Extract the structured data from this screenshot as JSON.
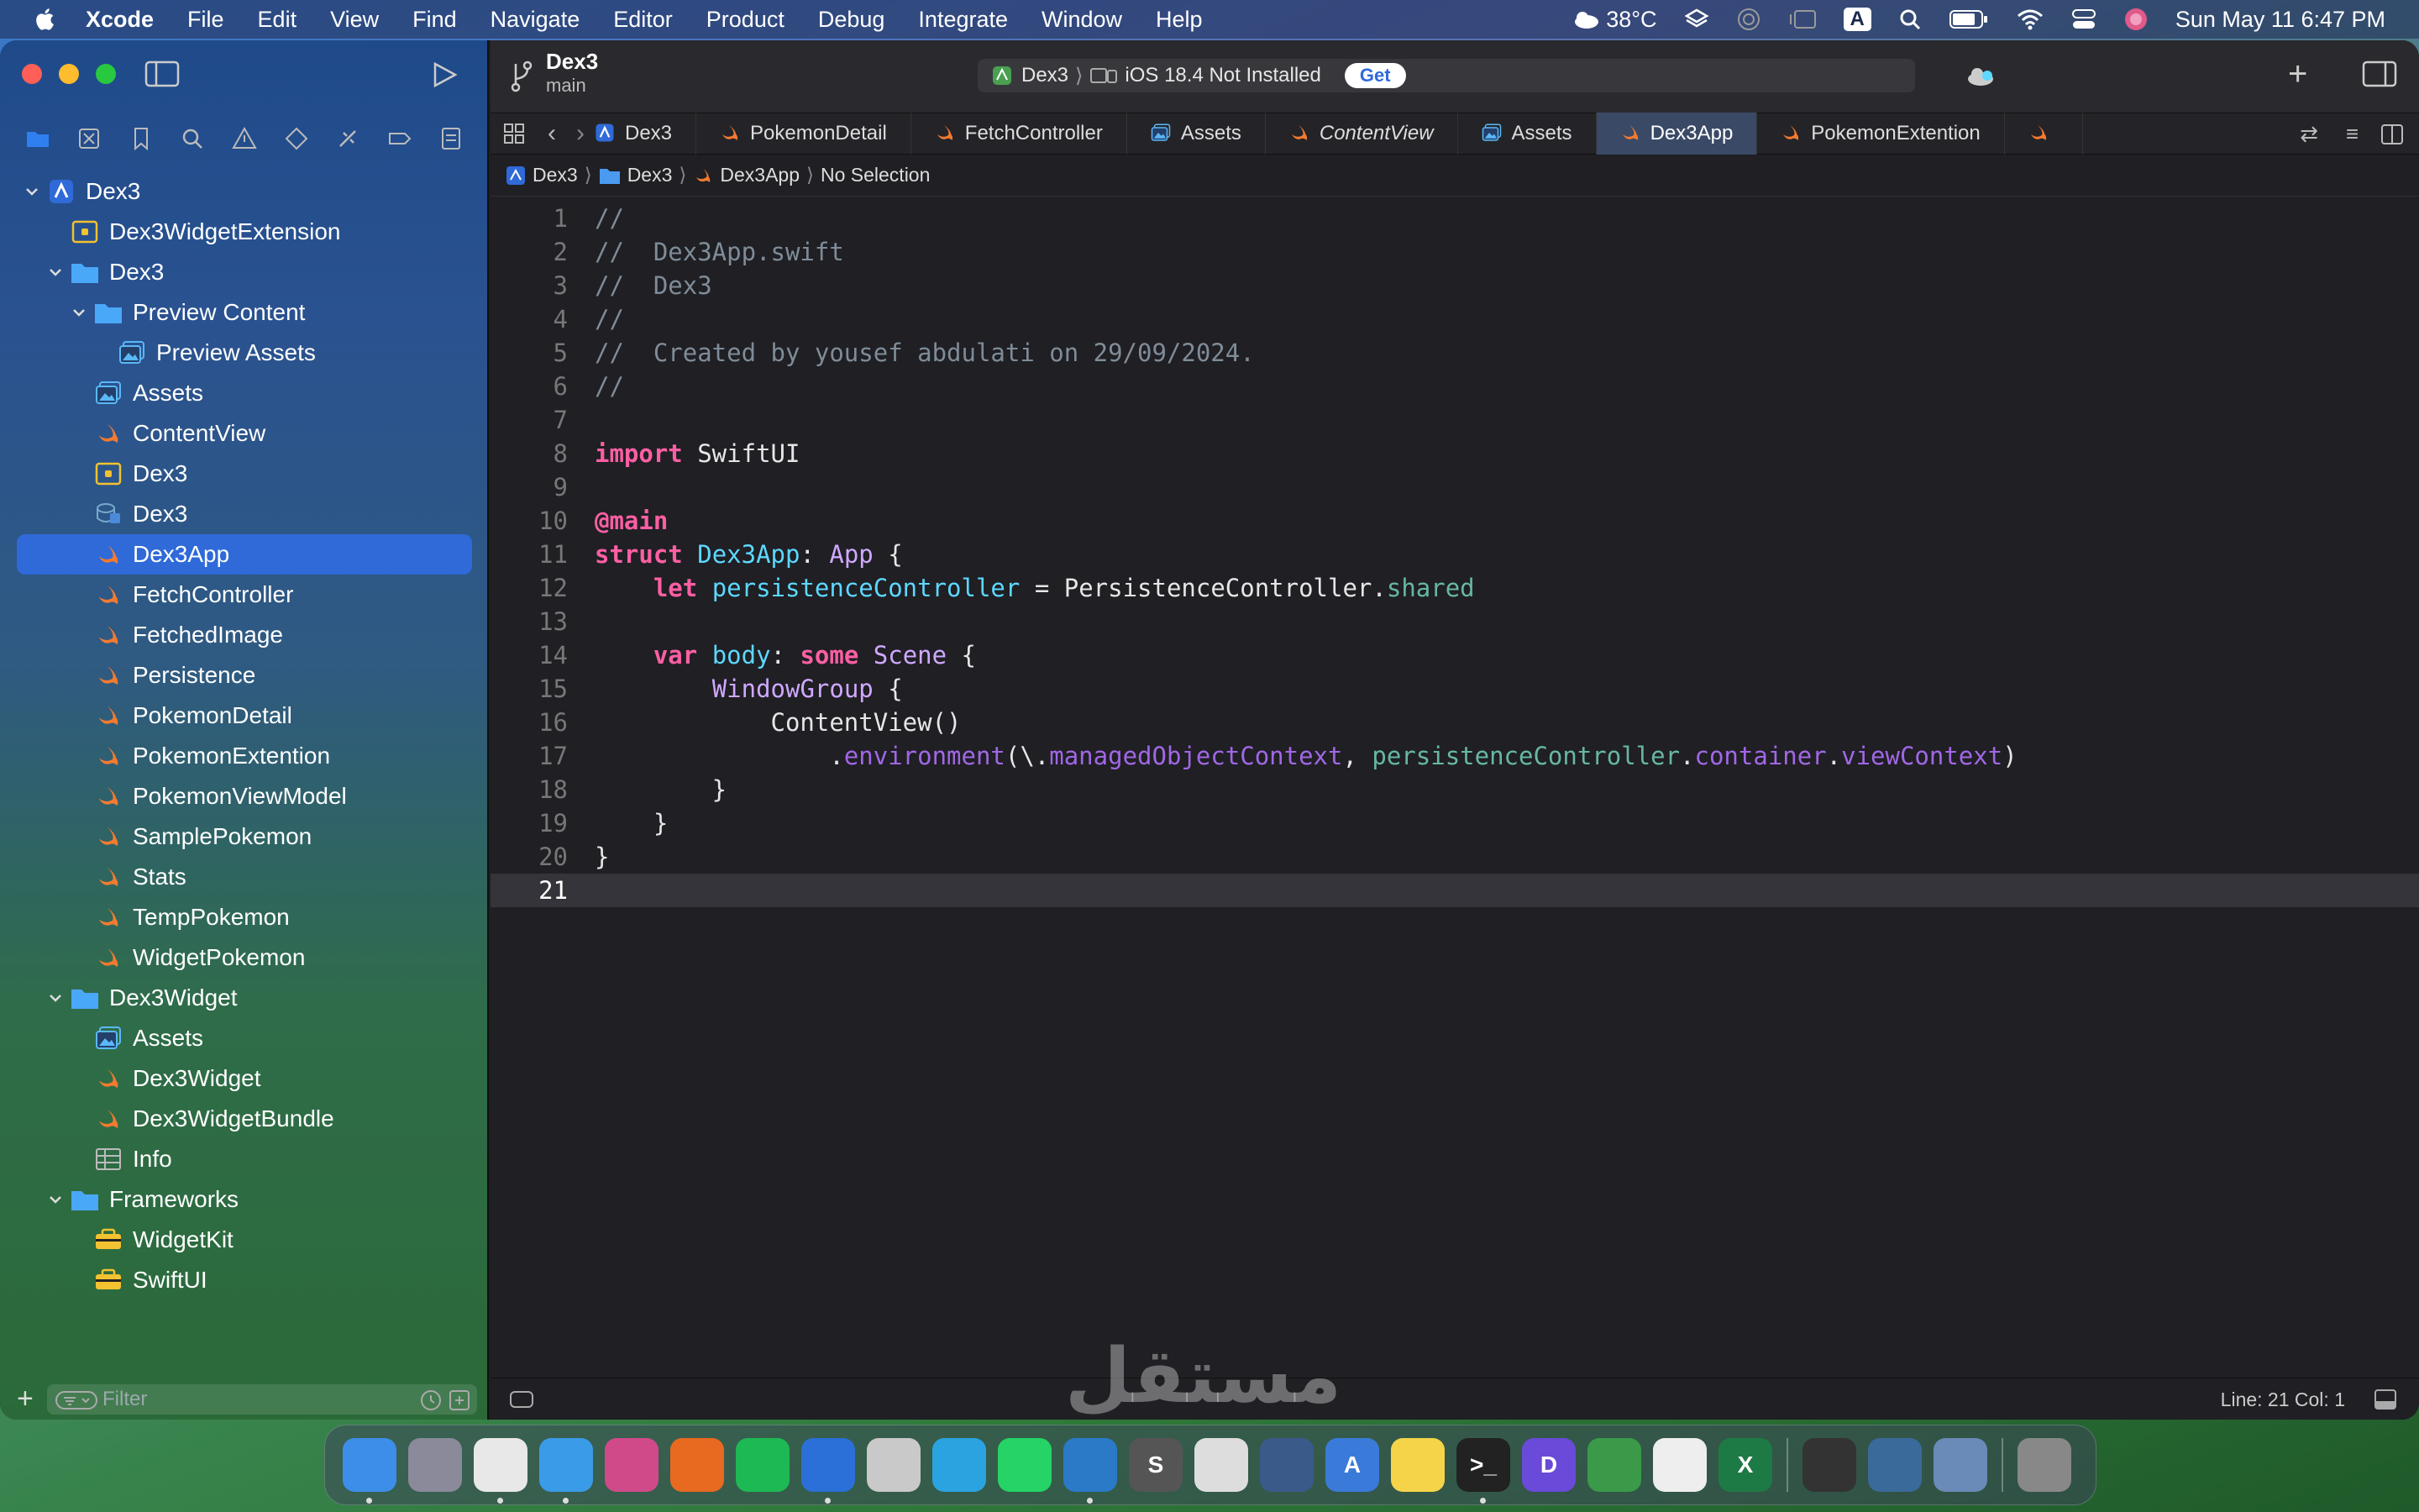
{
  "menubar": {
    "app": "Xcode",
    "items": [
      "File",
      "Edit",
      "View",
      "Find",
      "Navigate",
      "Editor",
      "Product",
      "Debug",
      "Integrate",
      "Window",
      "Help"
    ],
    "weather": "38°C",
    "datetime": "Sun May 11  6:47 PM",
    "input_source": "A"
  },
  "project": {
    "name": "Dex3",
    "branch": "main"
  },
  "scheme": {
    "target": "Dex3",
    "device": "iOS 18.4 Not Installed",
    "get_label": "Get"
  },
  "tabs": [
    "Dex3",
    "PokemonDetail",
    "FetchController",
    "Assets",
    "ContentView",
    "Assets",
    "Dex3App",
    "PokemonExtention"
  ],
  "breadcrumb": [
    "Dex3",
    "Dex3",
    "Dex3App",
    "No Selection"
  ],
  "navigator": [
    {
      "label": "Dex3",
      "depth": 0,
      "chev": "open",
      "icon": "project-icon"
    },
    {
      "label": "Dex3WidgetExtension",
      "depth": 1,
      "chev": "",
      "icon": "extension-icon"
    },
    {
      "label": "Dex3",
      "depth": 1,
      "chev": "open",
      "icon": "folder-icon"
    },
    {
      "label": "Preview Content",
      "depth": 2,
      "chev": "open",
      "icon": "folder-icon"
    },
    {
      "label": "Preview Assets",
      "depth": 3,
      "chev": "",
      "icon": "assets-icon"
    },
    {
      "label": "Assets",
      "depth": 2,
      "chev": "",
      "icon": "assets-icon"
    },
    {
      "label": "ContentView",
      "depth": 2,
      "chev": "",
      "icon": "swift-icon"
    },
    {
      "label": "Dex3",
      "depth": 2,
      "chev": "",
      "icon": "extension-icon"
    },
    {
      "label": "Dex3",
      "depth": 2,
      "chev": "",
      "icon": "coredata-icon"
    },
    {
      "label": "Dex3App",
      "depth": 2,
      "chev": "",
      "icon": "swift-icon",
      "selected": true
    },
    {
      "label": "FetchController",
      "depth": 2,
      "chev": "",
      "icon": "swift-icon"
    },
    {
      "label": "FetchedImage",
      "depth": 2,
      "chev": "",
      "icon": "swift-icon"
    },
    {
      "label": "Persistence",
      "depth": 2,
      "chev": "",
      "icon": "swift-icon"
    },
    {
      "label": "PokemonDetail",
      "depth": 2,
      "chev": "",
      "icon": "swift-icon"
    },
    {
      "label": "PokemonExtention",
      "depth": 2,
      "chev": "",
      "icon": "swift-icon"
    },
    {
      "label": "PokemonViewModel",
      "depth": 2,
      "chev": "",
      "icon": "swift-icon"
    },
    {
      "label": "SamplePokemon",
      "depth": 2,
      "chev": "",
      "icon": "swift-icon"
    },
    {
      "label": "Stats",
      "depth": 2,
      "chev": "",
      "icon": "swift-icon"
    },
    {
      "label": "TempPokemon",
      "depth": 2,
      "chev": "",
      "icon": "swift-icon"
    },
    {
      "label": "WidgetPokemon",
      "depth": 2,
      "chev": "",
      "icon": "swift-icon"
    },
    {
      "label": "Dex3Widget",
      "depth": 1,
      "chev": "open",
      "icon": "folder-icon"
    },
    {
      "label": "Assets",
      "depth": 2,
      "chev": "",
      "icon": "assets-icon"
    },
    {
      "label": "Dex3Widget",
      "depth": 2,
      "chev": "",
      "icon": "swift-icon"
    },
    {
      "label": "Dex3WidgetBundle",
      "depth": 2,
      "chev": "",
      "icon": "swift-icon"
    },
    {
      "label": "Info",
      "depth": 2,
      "chev": "",
      "icon": "plist-icon"
    },
    {
      "label": "Frameworks",
      "depth": 1,
      "chev": "open",
      "icon": "folder-icon"
    },
    {
      "label": "WidgetKit",
      "depth": 2,
      "chev": "",
      "icon": "framework-icon"
    },
    {
      "label": "SwiftUI",
      "depth": 2,
      "chev": "",
      "icon": "framework-icon"
    }
  ],
  "filter_placeholder": "Filter",
  "code": [
    [
      [
        "c",
        "//"
      ]
    ],
    [
      [
        "c",
        "//  Dex3App.swift"
      ]
    ],
    [
      [
        "c",
        "//  Dex3"
      ]
    ],
    [
      [
        "c",
        "//"
      ]
    ],
    [
      [
        "c",
        "//  Created by yousef abdulati on 29/09/2024."
      ]
    ],
    [
      [
        "c",
        "//"
      ]
    ],
    [],
    [
      [
        "k",
        "import"
      ],
      [
        "pl",
        " SwiftUI"
      ]
    ],
    [],
    [
      [
        "k",
        "@main"
      ]
    ],
    [
      [
        "k",
        "struct"
      ],
      [
        "pl",
        " "
      ],
      [
        "tp",
        "Dex3App"
      ],
      [
        "pl",
        ": "
      ],
      [
        "t",
        "App"
      ],
      [
        "pl",
        " {"
      ]
    ],
    [
      [
        "pl",
        "    "
      ],
      [
        "k",
        "let"
      ],
      [
        "pl",
        " "
      ],
      [
        "tp",
        "persistenceController"
      ],
      [
        "pl",
        " = PersistenceController."
      ],
      [
        "id",
        "shared"
      ]
    ],
    [],
    [
      [
        "pl",
        "    "
      ],
      [
        "k",
        "var"
      ],
      [
        "pl",
        " "
      ],
      [
        "tp",
        "body"
      ],
      [
        "pl",
        ": "
      ],
      [
        "k",
        "some"
      ],
      [
        "pl",
        " "
      ],
      [
        "t",
        "Scene"
      ],
      [
        "pl",
        " {"
      ]
    ],
    [
      [
        "pl",
        "        "
      ],
      [
        "t",
        "WindowGroup"
      ],
      [
        "pl",
        " {"
      ]
    ],
    [
      [
        "pl",
        "            ContentView()"
      ]
    ],
    [
      [
        "pl",
        "                ."
      ],
      [
        "pr",
        "environment"
      ],
      [
        "pl",
        "(\\."
      ],
      [
        "pr",
        "managedObjectContext"
      ],
      [
        "pl",
        ", "
      ],
      [
        "id",
        "persistenceController"
      ],
      [
        "pl",
        "."
      ],
      [
        "pr",
        "container"
      ],
      [
        "pl",
        "."
      ],
      [
        "pr",
        "viewContext"
      ],
      [
        "pl",
        ")"
      ]
    ],
    [
      [
        "pl",
        "        }"
      ]
    ],
    [
      [
        "pl",
        "    }"
      ]
    ],
    [
      [
        "pl",
        "}"
      ]
    ],
    []
  ],
  "current_line": 21,
  "status": {
    "position": "Line: 21  Col: 1"
  },
  "watermark": "مستقل",
  "dock": [
    {
      "name": "finder",
      "label": "",
      "color": "#3d8ee8",
      "run": true
    },
    {
      "name": "launchpad",
      "label": "",
      "color": "#8a8a9a"
    },
    {
      "name": "chrome",
      "label": "",
      "color": "#e8e8e8",
      "run": true
    },
    {
      "name": "safari",
      "label": "",
      "color": "#3a9be8",
      "run": true
    },
    {
      "name": "shortcuts",
      "label": "",
      "color": "#d04a8a"
    },
    {
      "name": "firefox",
      "label": "",
      "color": "#e86a20"
    },
    {
      "name": "spotify",
      "label": "",
      "color": "#1db954"
    },
    {
      "name": "xcode",
      "label": "",
      "color": "#2a70d8",
      "run": true
    },
    {
      "name": "simulator",
      "label": "",
      "color": "#c9c9c9"
    },
    {
      "name": "telegram",
      "label": "",
      "color": "#2aa3e0"
    },
    {
      "name": "whatsapp",
      "label": "",
      "color": "#25d366"
    },
    {
      "name": "vscode",
      "label": "",
      "color": "#2a7ac8",
      "run": true
    },
    {
      "name": "sublime",
      "label": "S",
      "color": "#555"
    },
    {
      "name": "chatgpt",
      "label": "",
      "color": "#ddd"
    },
    {
      "name": "cleanmymac",
      "label": "",
      "color": "#3a5a8a"
    },
    {
      "name": "instruments",
      "label": "A",
      "color": "#3a7ad8"
    },
    {
      "name": "notes",
      "label": "",
      "color": "#f5d44a"
    },
    {
      "name": "terminal",
      "label": ">_",
      "color": "#222",
      "run": true
    },
    {
      "name": "dash",
      "label": "D",
      "color": "#6a4ad8"
    },
    {
      "name": "circle-app",
      "label": "",
      "color": "#3a9a4a"
    },
    {
      "name": "textedit",
      "label": "",
      "color": "#eee"
    },
    {
      "name": "excel",
      "label": "X",
      "color": "#1e7a45"
    },
    {
      "name": "sep",
      "label": ""
    },
    {
      "name": "box",
      "label": "",
      "color": "#333"
    },
    {
      "name": "quicktime",
      "label": "",
      "color": "#3a6a9a"
    },
    {
      "name": "preview",
      "label": "",
      "color": "#6a8ab8"
    },
    {
      "name": "sep",
      "label": ""
    },
    {
      "name": "trash",
      "label": "",
      "color": "#888"
    }
  ]
}
